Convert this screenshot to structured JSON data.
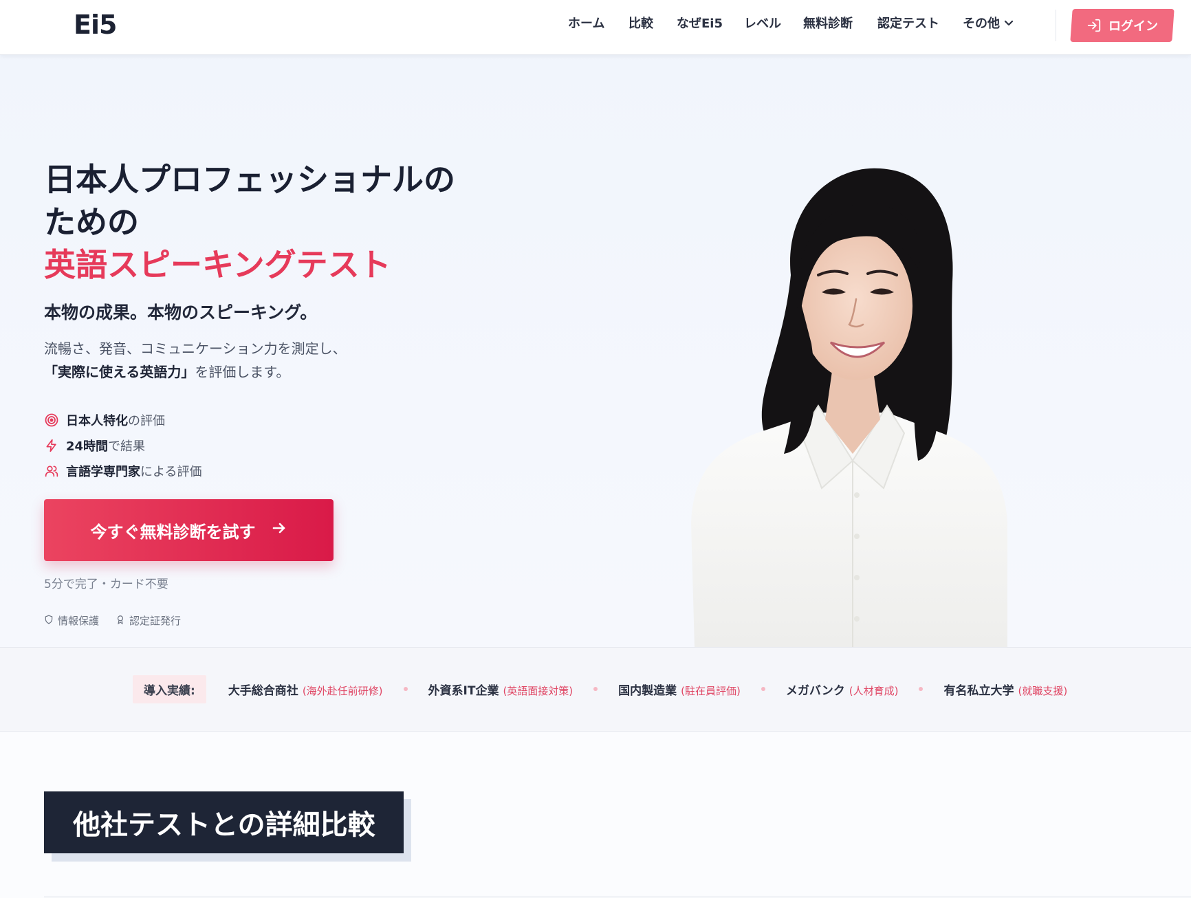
{
  "header": {
    "logo": "Ei5",
    "nav": [
      {
        "label": "ホーム"
      },
      {
        "label": "比較"
      },
      {
        "label": "なぜEi5"
      },
      {
        "label": "レベル"
      },
      {
        "label": "無料診断"
      },
      {
        "label": "認定テスト"
      }
    ],
    "nav_more": "その他",
    "login_label": "ログイン"
  },
  "hero": {
    "title_line1": "日本人プロフェッショナルの",
    "title_line2": "ための",
    "title_accent": "英語スピーキングテスト",
    "subtitle": "本物の成果。本物のスピーキング。",
    "desc_part1": "流暢さ、発音、コミュニケーション力を測定し、",
    "desc_bold": "「実際に使える英語力」",
    "desc_part2": "を評価します。",
    "features": [
      {
        "icon": "target-icon",
        "bold": "日本人特化",
        "rest": "の評価"
      },
      {
        "icon": "lightning-icon",
        "bold": "24時間",
        "rest": "で結果"
      },
      {
        "icon": "users-icon",
        "bold": "言語学専門家",
        "rest": "による評価"
      }
    ],
    "cta_label": "今すぐ無料診断を試す",
    "cta_note": "5分で完了・カード不要",
    "trust": [
      {
        "icon": "shield-icon",
        "label": "情報保護"
      },
      {
        "icon": "award-icon",
        "label": "認定証発行"
      }
    ]
  },
  "clients": {
    "label": "導入実績:",
    "items": [
      {
        "name": "大手総合商社",
        "note": "(海外赴任前研修)"
      },
      {
        "name": "外資系IT企業",
        "note": "(英語面接対策)"
      },
      {
        "name": "国内製造業",
        "note": "(駐在員評価)"
      },
      {
        "name": "メガバンク",
        "note": "(人材育成)"
      },
      {
        "name": "有名私立大学",
        "note": "(就職支援)"
      }
    ]
  },
  "comparison": {
    "title": "他社テストとの詳細比較"
  },
  "colors": {
    "accent": "#e63a5a",
    "login": "#f26a7f",
    "dark": "#1e2536"
  }
}
